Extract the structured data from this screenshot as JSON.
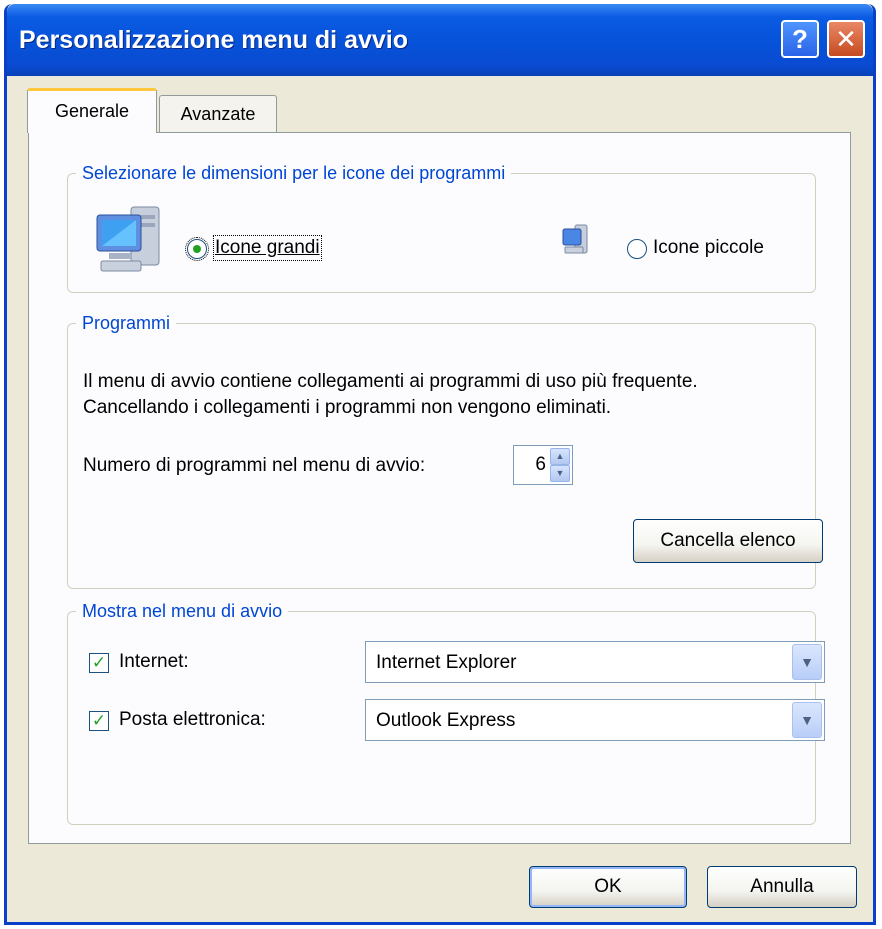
{
  "window": {
    "title": "Personalizzazione menu di avvio",
    "help_glyph": "?",
    "close_glyph": "✕",
    "accent": "#0a4bd2",
    "face": "#ece9d8"
  },
  "tabs": [
    {
      "label": "Generale",
      "active": true
    },
    {
      "label": "Avanzate",
      "active": false
    }
  ],
  "icon_size_group": {
    "legend": "Selezionare le dimensioni per le icone dei programmi",
    "large": {
      "label": "Icone grandi",
      "checked": true,
      "icon": "computer-large-icon"
    },
    "small": {
      "label": "Icone piccole",
      "checked": false,
      "icon": "computer-small-icon"
    }
  },
  "programs_group": {
    "legend": "Programmi",
    "line1": "Il menu di avvio contiene collegamenti ai programmi di uso più frequente.",
    "line2": "Cancellando i collegamenti i programmi non vengono eliminati.",
    "count_label": "Numero di programmi nel menu di avvio:",
    "count_value": "6",
    "clear_button": "Cancella elenco"
  },
  "show_group": {
    "legend": "Mostra nel menu di avvio",
    "internet": {
      "label": "Internet:",
      "checked": true,
      "value": "Internet Explorer"
    },
    "email": {
      "label": "Posta elettronica:",
      "checked": true,
      "value": "Outlook Express"
    }
  },
  "footer": {
    "ok": "OK",
    "cancel": "Annulla"
  }
}
